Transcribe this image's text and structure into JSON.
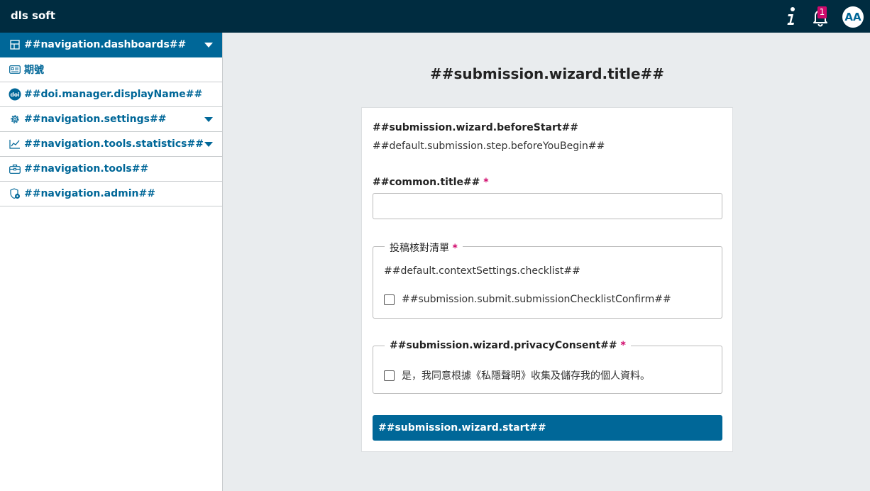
{
  "header": {
    "brand": "dls soft",
    "notification_count": "1",
    "avatar_initials": "AA"
  },
  "sidebar": {
    "items": [
      {
        "label": "##navigation.dashboards##",
        "icon": "dashboard-icon",
        "active": true,
        "has_submenu": true
      },
      {
        "label": "期號",
        "icon": "issue-icon",
        "active": false,
        "has_submenu": false
      },
      {
        "label": "##doi.manager.displayName##",
        "icon": "doi-icon",
        "icon_text": "doi",
        "active": false,
        "has_submenu": false
      },
      {
        "label": "##navigation.settings##",
        "icon": "gear-icon",
        "active": false,
        "has_submenu": true
      },
      {
        "label": "##navigation.tools.statistics##",
        "icon": "chart-line-icon",
        "active": false,
        "has_submenu": true
      },
      {
        "label": "##navigation.tools##",
        "icon": "toolbox-icon",
        "active": false,
        "has_submenu": false
      },
      {
        "label": "##navigation.admin##",
        "icon": "admin-icon",
        "active": false,
        "has_submenu": false
      }
    ]
  },
  "main": {
    "title": "##submission.wizard.title##",
    "before_start_heading": "##submission.wizard.beforeStart##",
    "before_start_text": "##default.submission.step.beforeYouBegin##",
    "title_field": {
      "label": "##common.title##",
      "required_mark": "*",
      "value": ""
    },
    "checklist": {
      "legend": "投稿核對清單",
      "required_mark": "*",
      "text": "##default.contextSettings.checklist##",
      "confirm_label": "##submission.submit.submissionChecklistConfirm##"
    },
    "privacy": {
      "legend": "##submission.wizard.privacyConsent##",
      "required_mark": "*",
      "confirm_label": "是，我同意根據《私隱聲明》收集及儲存我的個人資料。"
    },
    "start_button": "##submission.wizard.start##"
  },
  "colors": {
    "header_bg": "#002c40",
    "primary": "#006798",
    "required": "#d00a6c",
    "page_bg": "#e9ecee"
  }
}
